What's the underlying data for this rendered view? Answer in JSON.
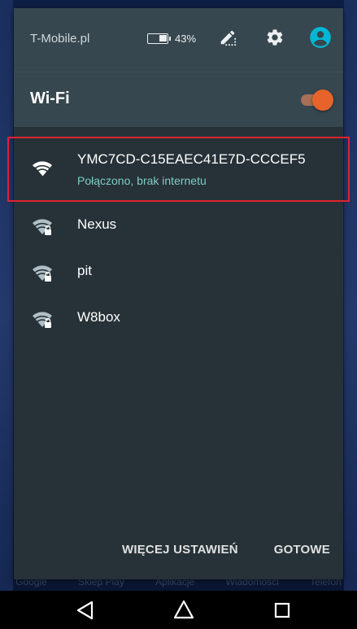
{
  "status_bar": {
    "carrier": "T-Mobile.pl",
    "battery_percent": "43%",
    "battery_level": 0.43
  },
  "wifi_panel": {
    "title": "Wi-Fi",
    "toggle_on": true,
    "accent_color": "#e6642b",
    "networks": [
      {
        "name": "YMC7CD-C15EAEC41E7D-CCCEF5",
        "status": "Połączono, brak internetu",
        "locked": false,
        "connected": true,
        "highlighted": true
      },
      {
        "name": "Nexus",
        "locked": true,
        "connected": false
      },
      {
        "name": "pit",
        "locked": true,
        "connected": false
      },
      {
        "name": "W8box",
        "locked": true,
        "connected": false
      }
    ],
    "actions": {
      "more_settings": "WIĘCEJ USTAWIEŃ",
      "done": "GOTOWE"
    }
  },
  "background_apps": [
    "Google",
    "Sklep Play",
    "Aplikacje",
    "Wiadomości",
    "Telefon"
  ],
  "nav_bar": {
    "back_icon": "back-triangle-icon",
    "home_icon": "home-circle-icon",
    "recents_icon": "recents-square-icon"
  }
}
